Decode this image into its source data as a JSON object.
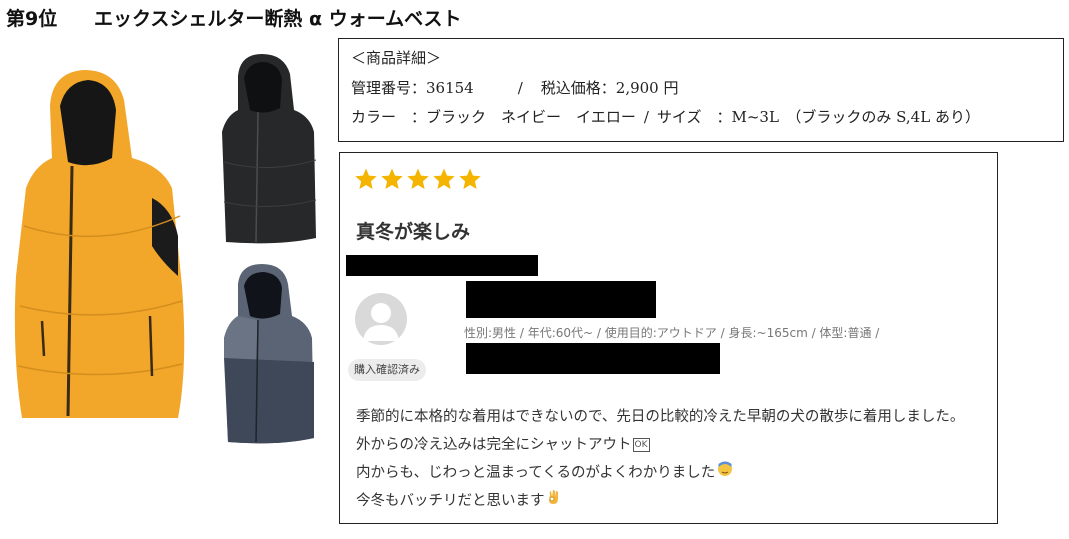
{
  "heading": {
    "rank": "第9位",
    "product_name": "エックスシェルター断熱 α ウォームベスト"
  },
  "images": [
    {
      "name": "vest-yellow",
      "color": "#f2a72a"
    },
    {
      "name": "vest-black",
      "color": "#262829"
    },
    {
      "name": "vest-navy",
      "color": "#4a5466"
    }
  ],
  "details": {
    "header": "＜商品詳細＞",
    "management_number": "管理番号：36154",
    "slash1": "/",
    "price": "税込価格：2,900 円",
    "colors": "カラー　：ブラック　ネイビー　イエロー",
    "slash2": "/",
    "sizes": "サイズ　：M~3L　（ブラックのみ S,4L あり）"
  },
  "review": {
    "rating": 5,
    "star_color": "#f5b400",
    "title": "真冬が楽しみ",
    "badge": "購入確認済み",
    "profile": "性別:男性 / 年代:60代~ / 使用目的:アウトドア / 身長:~165cm / 体型:普通 /",
    "body": [
      "季節的に本格的な着用はできないので、先日の比較的冷えた早朝の犬の散歩に着用しました。",
      "外からの冷え込みは完全にシャットアウト",
      "内からも、じわっと温まってくるのがよくわかりました",
      "今冬もバッチリだと思います"
    ],
    "ok_symbol": "OK"
  }
}
